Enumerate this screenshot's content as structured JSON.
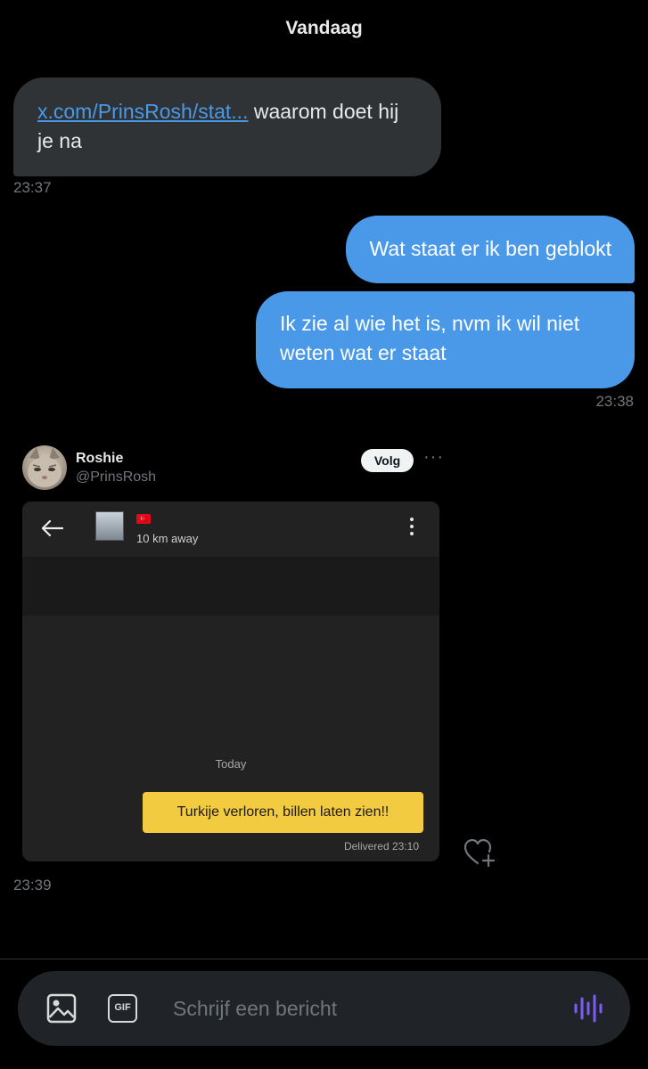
{
  "header": {
    "day": "Vandaag"
  },
  "messages": [
    {
      "link": "x.com/PrinsRosh/stat...",
      "text": " waarom doet hij je na",
      "time": "23:37"
    },
    {
      "text": "Wat staat er ik ben geblokt"
    },
    {
      "text": "Ik zie al wie het is, nvm ik wil niet weten wat er staat",
      "time": "23:38"
    }
  ],
  "shared_post": {
    "author_name": "Roshie",
    "author_handle": "@PrinsRosh",
    "follow_label": "Volg",
    "more_label": "···",
    "time": "23:39",
    "screenshot": {
      "flag": "🇹🇷",
      "distance": "10 km away",
      "date_label": "Today",
      "message": "Turkije verloren, billen laten zien!!",
      "status": "Delivered 23:10"
    }
  },
  "composer": {
    "placeholder": "Schrijf een bericht",
    "gif_label": "GIF"
  },
  "colors": {
    "accent": "#4a99e9",
    "voice": "#7b5cf5",
    "bubble_in": "#2f3336",
    "highlight": "#f3cb41"
  }
}
